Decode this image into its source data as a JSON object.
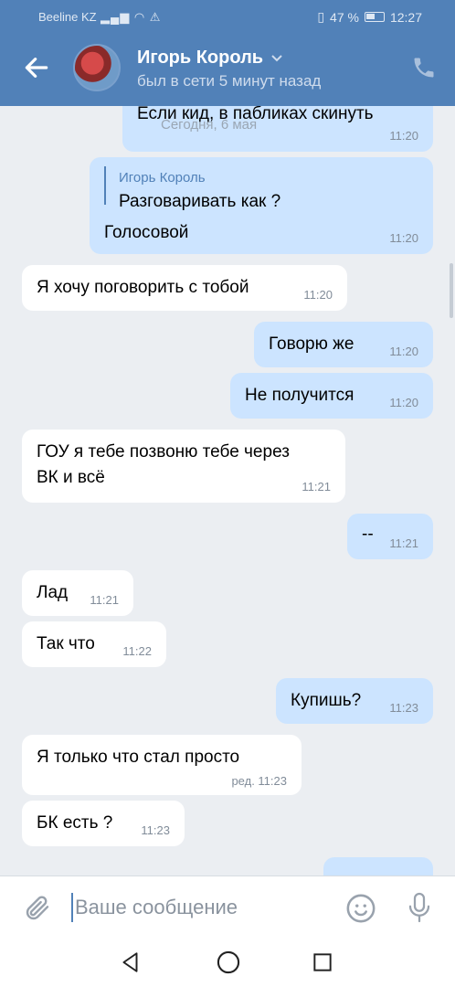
{
  "status_bar": {
    "carrier": "Beeline KZ",
    "battery": "47 %",
    "time": "12:27"
  },
  "header": {
    "contact_name": "Игорь Король",
    "last_seen": "был в сети 5 минут назад"
  },
  "chat": {
    "date_separator": "Сегодня, 6 мая",
    "messages": [
      {
        "dir": "out",
        "text": "Если кид, в пабликах скинуть",
        "time": "11:20"
      },
      {
        "dir": "out",
        "quote_author": "Игорь Король",
        "quote_text": "Разговаривать как ?",
        "text": "Голосовой",
        "time": "11:20"
      },
      {
        "dir": "in",
        "text": "Я хочу поговорить с тобой",
        "time": "11:20"
      },
      {
        "dir": "out",
        "text": "Говорю же",
        "time": "11:20"
      },
      {
        "dir": "out",
        "text": "Не получится",
        "time": "11:20"
      },
      {
        "dir": "in",
        "text_line1": "ГОУ я тебе позвоню тебе через",
        "text_line2": "ВК и всё",
        "time": "11:21"
      },
      {
        "dir": "out",
        "text": "--",
        "time": "11:21"
      },
      {
        "dir": "in",
        "text": "Лад",
        "time": "11:21"
      },
      {
        "dir": "in",
        "text": "Так что",
        "time": "11:22"
      },
      {
        "dir": "out",
        "text": "Купишь?",
        "time": "11:23"
      },
      {
        "dir": "in",
        "text": "Я только что стал просто",
        "time": "ред. 11:23"
      },
      {
        "dir": "in",
        "text": "БК есть ?",
        "time": "11:23"
      }
    ]
  },
  "composer": {
    "placeholder": "Ваше сообщение"
  },
  "colors": {
    "brand": "#5181b8",
    "incoming_bubble": "#ffffff",
    "outgoing_bubble": "#cce4ff",
    "background": "#ebeef2"
  },
  "icons": [
    "back-arrow-icon",
    "chevron-down-icon",
    "phone-icon",
    "paperclip-icon",
    "smile-icon",
    "microphone-icon",
    "nav-back-icon",
    "nav-home-icon",
    "nav-recent-icon"
  ]
}
